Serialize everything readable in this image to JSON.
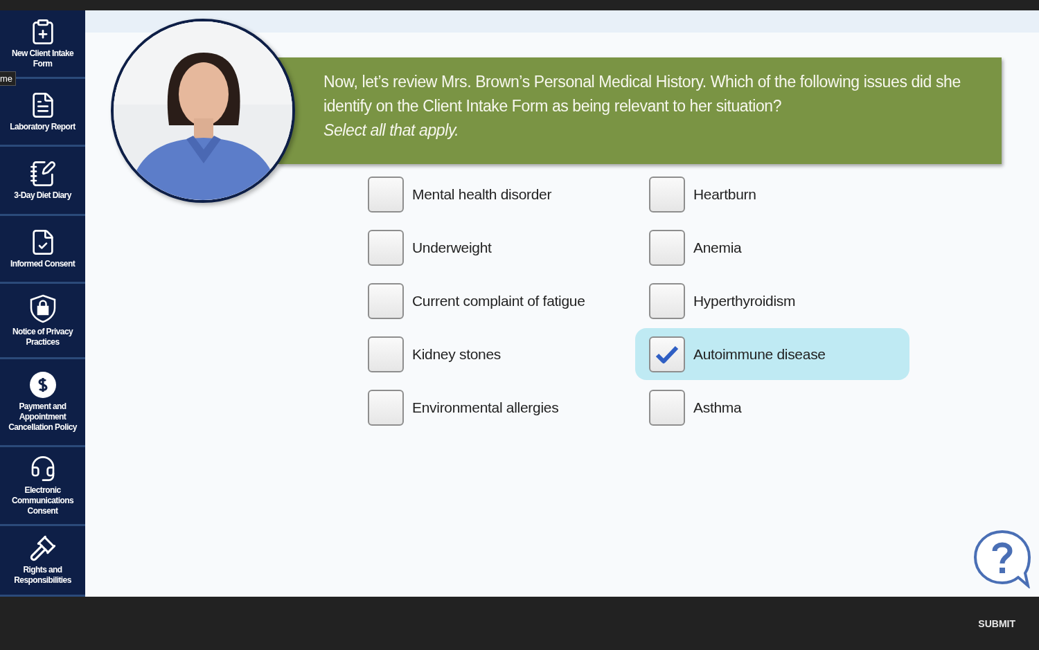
{
  "sidebar": {
    "items": [
      {
        "label": "New Client Intake Form"
      },
      {
        "label": "Laboratory Report"
      },
      {
        "label": "3-Day Diet Diary"
      },
      {
        "label": "Informed Consent"
      },
      {
        "label": "Notice of Privacy Practices"
      },
      {
        "label": "Payment and Appointment Cancellation Policy"
      },
      {
        "label": "Electronic Communications Consent"
      },
      {
        "label": "Rights and Responsibilities"
      }
    ]
  },
  "tooltip": "me",
  "question": "Now, let’s review Mrs. Brown’s Personal Medical History.  Which of the following issues did she identify on the Client Intake Form as being relevant to her situation?",
  "instruction": "Select all that apply.",
  "option_columns": [
    [
      {
        "label": "Mental health disorder",
        "checked": false
      },
      {
        "label": "Underweight",
        "checked": false
      },
      {
        "label": "Current complaint of fatigue",
        "checked": false
      },
      {
        "label": "Kidney stones",
        "checked": false
      },
      {
        "label": "Environmental allergies",
        "checked": false
      }
    ],
    [
      {
        "label": "Heartburn",
        "checked": false
      },
      {
        "label": "Anemia",
        "checked": false
      },
      {
        "label": "Hyperthyroidism",
        "checked": false
      },
      {
        "label": "Autoimmune disease",
        "checked": true
      },
      {
        "label": "Asthma",
        "checked": false
      }
    ]
  ],
  "submit": "SUBMIT"
}
